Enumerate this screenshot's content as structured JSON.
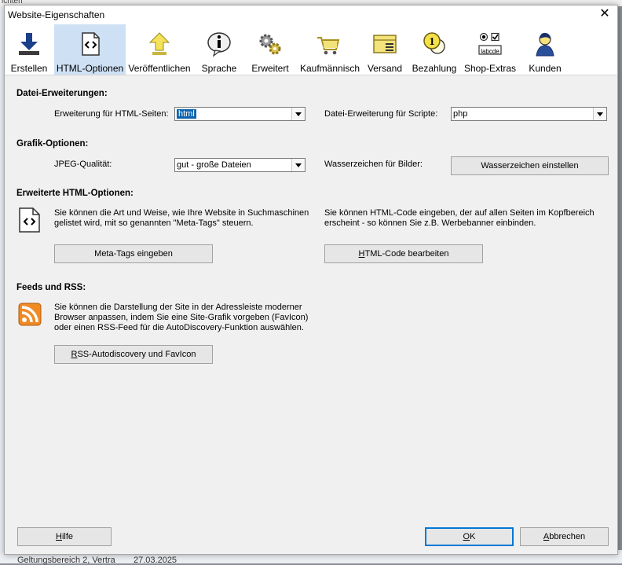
{
  "background": {
    "top_text": "ichten",
    "bottom_left": "Geltungsbereich 2, Vertra",
    "bottom_date": "27.03.2025"
  },
  "dialog": {
    "title": "Website-Eigenschaften",
    "close_glyph": "✕"
  },
  "toolbar": {
    "items": [
      {
        "label": "Erstellen",
        "icon": "download-arrow-icon"
      },
      {
        "label": "HTML-Optionen",
        "icon": "html-code-icon",
        "active": true
      },
      {
        "label": "Veröffentlichen",
        "icon": "upload-arrow-icon"
      },
      {
        "label": "Sprache",
        "icon": "info-bubble-icon"
      },
      {
        "label": "Erweitert",
        "icon": "gears-icon"
      },
      {
        "label": "Kaufmännisch",
        "icon": "shopping-cart-icon"
      },
      {
        "label": "Versand",
        "icon": "package-icon"
      },
      {
        "label": "Bezahlung",
        "icon": "coins-icon"
      },
      {
        "label": "Shop-Extras",
        "icon": "form-controls-icon",
        "icon_text": "labcde"
      },
      {
        "label": "Kunden",
        "icon": "customer-icon"
      }
    ]
  },
  "file_ext": {
    "heading": "Datei-Erweiterungen:",
    "html_label": "Erweiterung für HTML-Seiten:",
    "html_value": "html",
    "script_label": "Datei-Erweiterung für Scripte:",
    "script_value": "php"
  },
  "graphics": {
    "heading": "Grafik-Optionen:",
    "jpeg_label": "JPEG-Qualität:",
    "jpeg_value": "gut - große Dateien",
    "watermark_label": "Wasserzeichen für Bilder:",
    "watermark_button": "Wasserzeichen einstellen"
  },
  "advanced_html": {
    "heading": "Erweiterte HTML-Optionen:",
    "meta_desc": "Sie können die Art und Weise, wie Ihre Website in Suchmaschinen gelistet wird, mit so genannten \"Meta-Tags\" steuern.",
    "meta_button": "Meta-Tags eingeben",
    "code_desc": "Sie können HTML-Code eingeben, der auf allen Seiten im Kopfbereich erscheint - so können Sie z.B. Werbebanner einbinden.",
    "code_button_prefix": "",
    "code_button_ul": "H",
    "code_button_rest": "TML-Code bearbeiten"
  },
  "feeds": {
    "heading": "Feeds und RSS:",
    "desc": "Sie können die Darstellung der Site in der Adressleiste moderner Browser anpassen, indem Sie eine Site-Grafik vorgeben (FavIcon) oder einen RSS-Feed für die AutoDiscovery-Funktion auswählen.",
    "button_ul": "R",
    "button_rest": "SS-Autodiscovery und FavIcon"
  },
  "footer": {
    "help_ul": "H",
    "help_rest": "ilfe",
    "ok_ul": "O",
    "ok_rest": "K",
    "cancel_ul": "A",
    "cancel_rest": "bbrechen"
  },
  "colors": {
    "accent_active_tab": "#cde0f4",
    "selection": "#0a64ad",
    "rss_orange": "#f08a24"
  }
}
